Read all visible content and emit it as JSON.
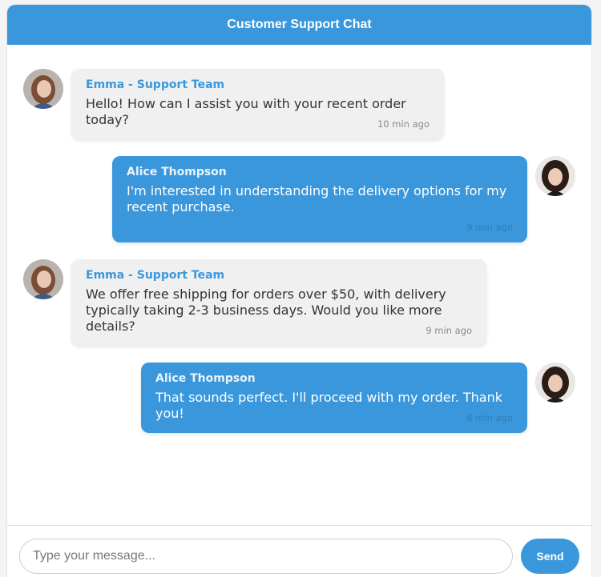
{
  "header": {
    "title": "Customer Support Chat"
  },
  "messages": [
    {
      "role": "agent",
      "sender": "Emma - Support Team",
      "text": "Hello! How can I assist you with your recent order today?",
      "time": "10 min ago"
    },
    {
      "role": "user",
      "sender": "Alice Thompson",
      "text": "I'm interested in understanding the delivery options for my recent purchase.",
      "time": "9 min ago"
    },
    {
      "role": "agent",
      "sender": "Emma - Support Team",
      "text": "We offer free shipping for orders over $50, with delivery typically taking 2-3 business days. Would you like more details?",
      "time": "9 min ago"
    },
    {
      "role": "user",
      "sender": "Alice Thompson",
      "text": "That sounds perfect. I'll proceed with my order. Thank you!",
      "time": "8 min ago"
    }
  ],
  "input": {
    "placeholder": "Type your message...",
    "value": ""
  },
  "send": {
    "label": "Send"
  },
  "colors": {
    "accent": "#3a97db",
    "agent_bubble": "#f0f0f0"
  }
}
